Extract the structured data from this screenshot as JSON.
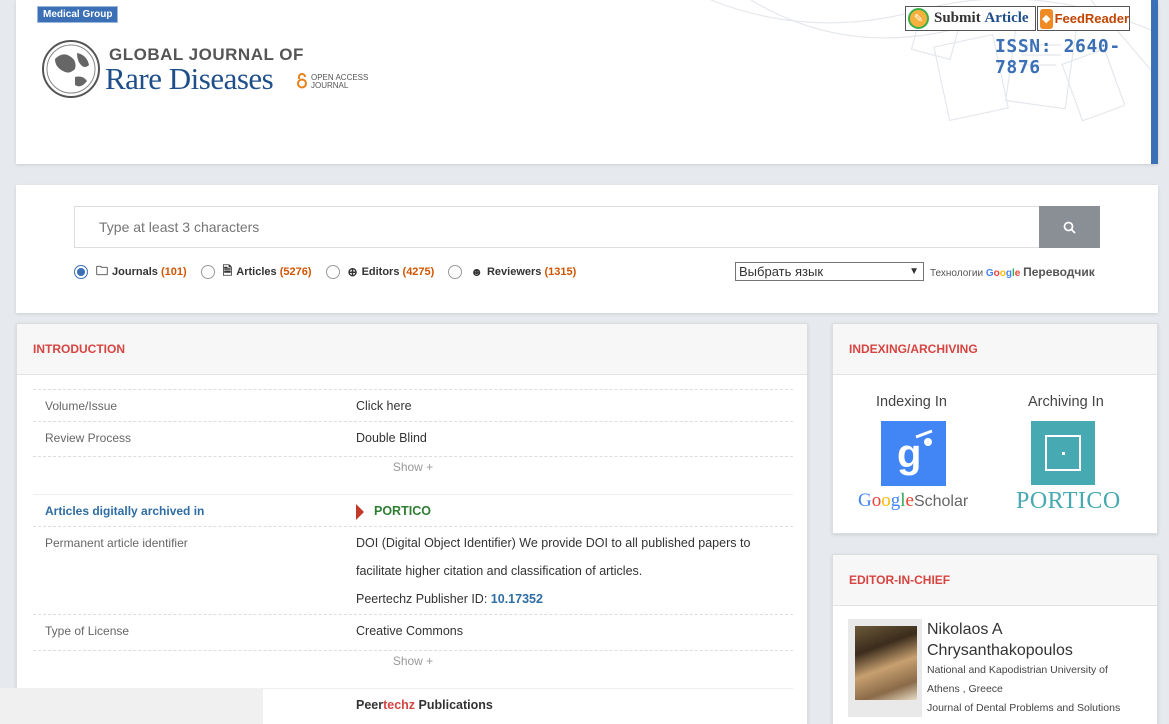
{
  "header": {
    "badge": "Medical Group",
    "logo_line1": "GLOBAL JOURNAL OF",
    "logo_line2": "Rare Diseases",
    "open_access": "OPEN ACCESS JOURNAL",
    "submit_prefix": "Submit ",
    "submit_word": "Article",
    "feed_reader": "FeedReader",
    "issn": "ISSN: 2640-7876"
  },
  "search": {
    "placeholder": "Type at least 3 characters",
    "options": [
      {
        "label": "Journals",
        "count": "(101)",
        "icon": "folder-search-icon",
        "selected": true
      },
      {
        "label": "Articles",
        "count": "(5276)",
        "icon": "document-search-icon",
        "selected": false
      },
      {
        "label": "Editors",
        "count": "(4275)",
        "icon": "magnifier-icon",
        "selected": false
      },
      {
        "label": "Reviewers",
        "count": "(1315)",
        "icon": "user-search-icon",
        "selected": false
      }
    ],
    "language_select": "Выбрать язык",
    "translate_prefix": "Технологии",
    "translate_google": "Google",
    "translate_suffix": "Переводчик"
  },
  "intro": {
    "title": "INTRODUCTION",
    "volume_key": "Volume/Issue",
    "volume_val": "Click here",
    "review_key": "Review Process",
    "review_val": "Double Blind",
    "show1": "Show +",
    "archived_key": "Articles digitally archived in",
    "archived_val": "PORTICO",
    "perm_key": "Permanent article identifier",
    "perm_line1": "DOI (Digital Object Identifier) We provide DOI to all published papers to",
    "perm_line2": "facilitate higher citation and classification of articles.",
    "perm_line3_prefix": "Peertechz Publisher ID: ",
    "perm_line3_id": "10.17352",
    "license_key": "Type of License",
    "license_val": "Creative Commons",
    "show2": "Show +",
    "pub_prefix": "Peer",
    "pub_accent": "techz",
    "pub_suffix": " Publications"
  },
  "indexing": {
    "title": "INDEXING/ARCHIVING",
    "indexing_in": "Indexing In",
    "archiving_in": "Archiving In",
    "google_scholar_google": "Google",
    "google_scholar_scholar": "Scholar",
    "portico": "PORTICO"
  },
  "editor": {
    "title": "EDITOR-IN-CHIEF",
    "name": "Nikolaos A Chrysanthakopoulos",
    "affiliation1": "National and Kapodistrian University of",
    "affiliation2": "Athens , Greece",
    "affiliation3": "Journal of Dental Problems and Solutions"
  },
  "colors": {
    "accent_blue": "#3b6fb6",
    "section_red": "#d64541",
    "portico_teal": "#47a9b1",
    "link_blue": "#2e6da4"
  }
}
